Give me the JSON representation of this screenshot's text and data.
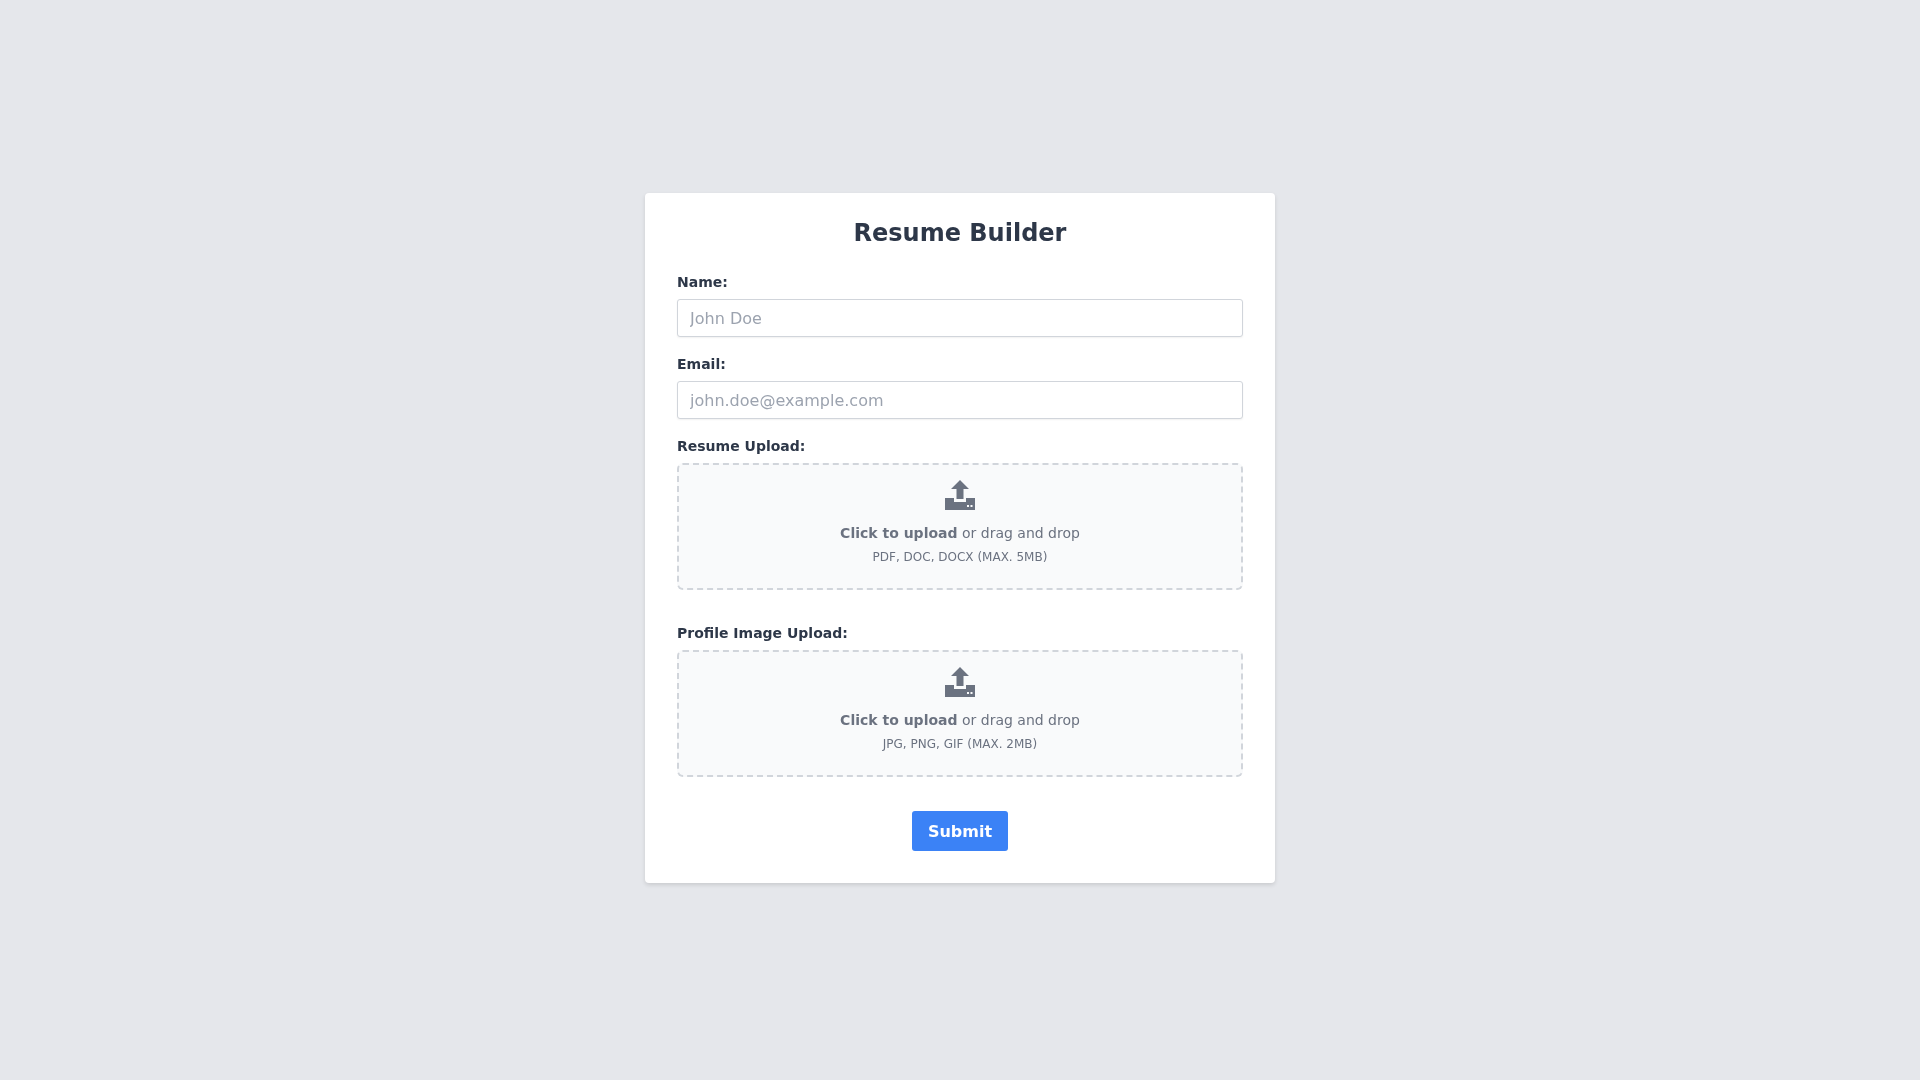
{
  "title": "Resume Builder",
  "fields": [
    {
      "label": "Name:",
      "placeholder": "John Doe"
    },
    {
      "label": "Email:",
      "placeholder": "john.doe@example.com"
    }
  ],
  "uploads": [
    {
      "label": "Resume Upload:",
      "prompt": "**Click to upload** or drag and drop",
      "formats": "PDF, DOC, DOCX (MAX. 5MB)"
    },
    {
      "label": "Profile Image Upload:",
      "prompt": "**Click to upload** or drag and drop",
      "formats": "JPG, PNG, GIF (MAX. 2MB)"
    }
  ],
  "submit": "Submit"
}
